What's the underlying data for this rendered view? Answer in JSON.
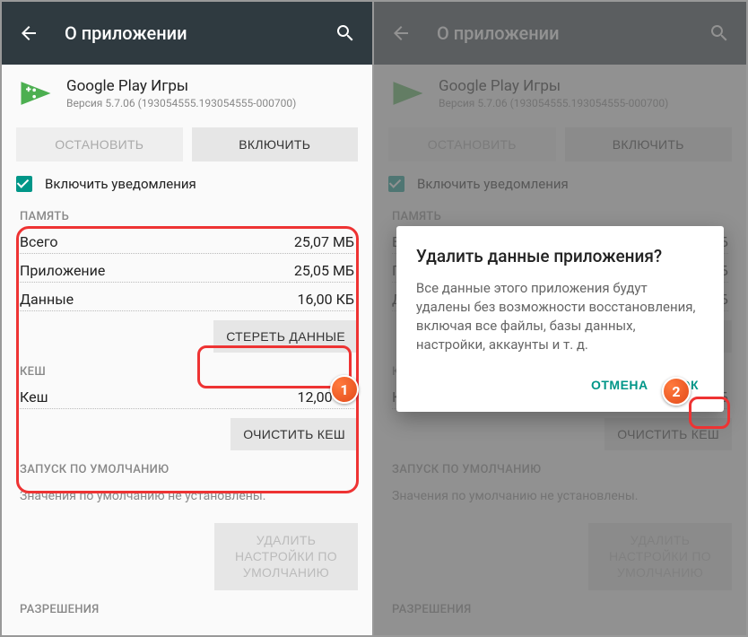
{
  "appbar": {
    "title": "О приложении"
  },
  "app": {
    "name": "Google Play Игры",
    "version": "Версия 5.7.06 (193054555.193054555-000700)"
  },
  "buttons": {
    "stop": "ОСТАНОВИТЬ",
    "enable": "ВКЛЮЧИТЬ"
  },
  "notify": {
    "label": "Включить уведомления"
  },
  "storage": {
    "header": "ПАМЯТЬ",
    "rows": [
      {
        "k": "Всего",
        "v": "25,07 МБ"
      },
      {
        "k": "Приложение",
        "v": "25,05 МБ"
      },
      {
        "k": "Данные",
        "v": "16,00 КБ"
      }
    ],
    "clear_data": "СТЕРЕТЬ ДАННЫЕ"
  },
  "cache": {
    "header": "КЕШ",
    "rows": [
      {
        "k": "Кеш",
        "v": "12,00 КБ"
      }
    ],
    "clear_cache": "ОЧИСТИТЬ КЕШ"
  },
  "defaults": {
    "header": "ЗАПУСК ПО УМОЛЧАНИЮ",
    "text": "Значения по умолчанию не установлены.",
    "clear": "УДАЛИТЬ НАСТРОЙКИ ПО УМОЛЧАНИЮ"
  },
  "permissions": {
    "header": "РАЗРЕШЕНИЯ"
  },
  "dialog": {
    "title": "Удалить данные приложения?",
    "body": "Все данные этого приложения будут удалены без возможности восстановления, включая все файлы, базы данных, настройки, аккаунты и т. д.",
    "cancel": "ОТМЕНА",
    "ok": "ОК"
  },
  "badges": {
    "one": "1",
    "two": "2"
  }
}
